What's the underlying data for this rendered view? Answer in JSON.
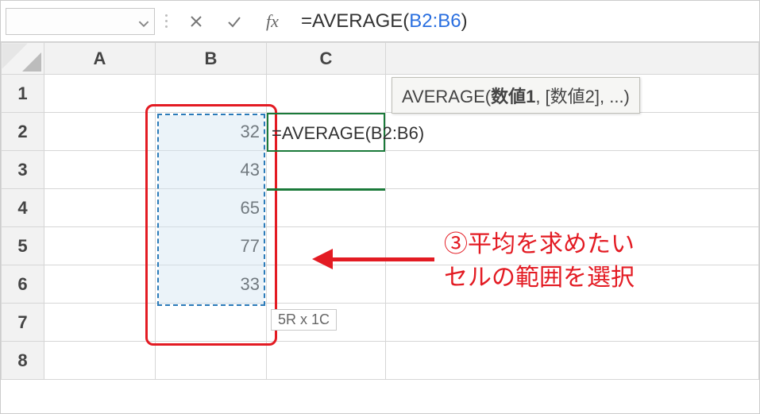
{
  "formula_bar": {
    "name_box_value": "",
    "cancel_title": "キャンセル",
    "accept_title": "入力",
    "fx_title": "関数の挿入",
    "fx_label": "fx",
    "formula_prefix": "=AVERAGE(",
    "formula_ref": "B2:B6",
    "formula_suffix": ")"
  },
  "tooltip": {
    "fn_name": "AVERAGE(",
    "arg1": "数値1",
    "rest": ", [数値2], ...)"
  },
  "columns": {
    "A": "A",
    "B": "B",
    "C": "C"
  },
  "rows": {
    "r1": "1",
    "r2": "2",
    "r3": "3",
    "r4": "4",
    "r5": "5",
    "r6": "6",
    "r7": "7",
    "r8": "8"
  },
  "data": {
    "b2": "32",
    "b3": "43",
    "b4": "65",
    "b5": "77",
    "b6": "33"
  },
  "in_cell_formula": "=AVERAGE(B2:B6)",
  "selection_size": "5R x 1C",
  "annotation": {
    "line1": "③平均を求めたい",
    "line2": "セルの範囲を選択"
  }
}
